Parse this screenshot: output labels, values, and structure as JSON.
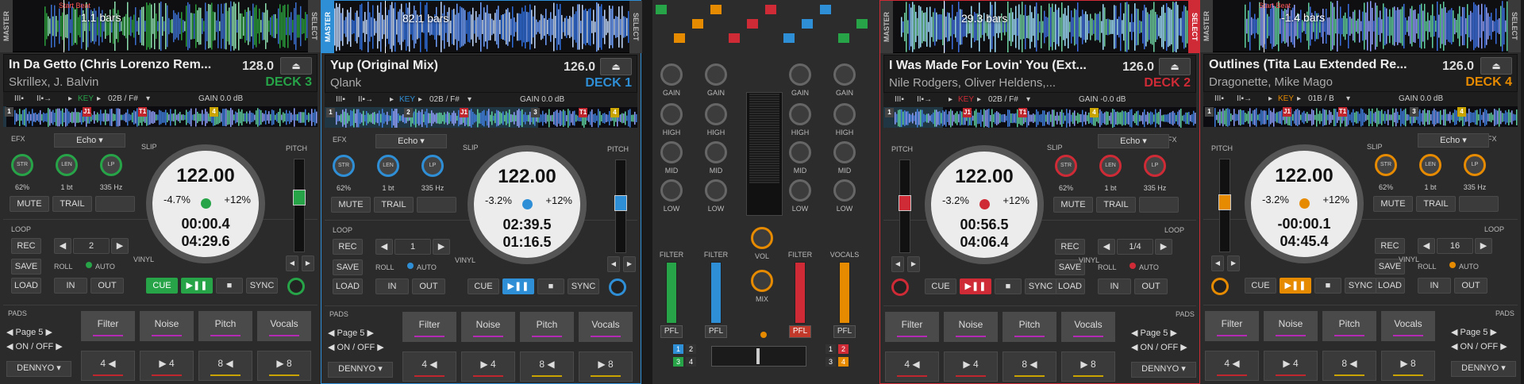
{
  "decks": [
    {
      "id": "deck3",
      "accent": "#27a348",
      "title": "In Da Getto (Chris Lorenzo Rem...",
      "artist": "Skrillex, J. Balvin",
      "bpm": "128.0",
      "deck_label": "DECK 3",
      "bars": "1.1 bars",
      "start_beat": "Start Beat",
      "key_label": "KEY",
      "key": "02B / F#",
      "gain": "GAIN 0.0 dB",
      "efx": "EFX",
      "effect": "Echo",
      "slip": "SLIP",
      "pitch": "PITCH",
      "str_label": "STR",
      "str": "62%",
      "len_label": "LEN",
      "len": "1 bt",
      "lp_label": "LP",
      "lp": "335 Hz",
      "mute": "MUTE",
      "trail": "TRAIL",
      "loop": "LOOP",
      "loop_size": "2",
      "rec": "REC",
      "save": "SAVE",
      "load": "LOAD",
      "roll": "ROLL",
      "auto": "AUTO",
      "in": "IN",
      "out": "OUT",
      "vinyl": "VINYL",
      "jog_bpm": "122.00",
      "pitch_minus": "-4.7%",
      "pitch_plus": "+12%",
      "time_elapsed": "00:00.4",
      "time_remain": "04:29.6",
      "cue": "CUE",
      "play": "▶❚❚",
      "stop": "■",
      "sync": "SYNC",
      "pads": "PADS",
      "page": "Page 5",
      "onoff": "ON / OFF",
      "user": "DENNYO",
      "pad_names": [
        "Filter",
        "Noise",
        "Pitch",
        "Vocals"
      ],
      "pad_bottom": [
        "4 ◀",
        "▶ 4",
        "8 ◀",
        "▶ 8"
      ],
      "cue_marks": [
        "1",
        "J1",
        "T1",
        "4"
      ],
      "master": "MASTER",
      "select": "SELECT",
      "progress": 0.01
    },
    {
      "id": "deck1",
      "accent": "#2f8fd6",
      "title": "Yup (Original Mix)",
      "artist": "Qlank",
      "bpm": "126.0",
      "deck_label": "DECK 1",
      "bars": "82.1 bars",
      "key_label": "KEY",
      "key": "02B / F#",
      "gain": "GAIN 0.0 dB",
      "efx": "EFX",
      "effect": "Echo",
      "slip": "SLIP",
      "pitch": "PITCH",
      "str_label": "STR",
      "str": "62%",
      "len_label": "LEN",
      "len": "1 bt",
      "lp_label": "LP",
      "lp": "335 Hz",
      "mute": "MUTE",
      "trail": "TRAIL",
      "loop": "LOOP",
      "loop_size": "1",
      "rec": "REC",
      "save": "SAVE",
      "load": "LOAD",
      "roll": "ROLL",
      "auto": "AUTO",
      "in": "IN",
      "out": "OUT",
      "vinyl": "VINYL",
      "jog_bpm": "122.00",
      "pitch_minus": "-3.2%",
      "pitch_plus": "+12%",
      "time_elapsed": "02:39.5",
      "time_remain": "01:16.5",
      "cue": "CUE",
      "play": "▶❚❚",
      "stop": "■",
      "sync": "SYNC",
      "pads": "PADS",
      "page": "Page 5",
      "onoff": "ON / OFF",
      "user": "DENNYO",
      "pad_names": [
        "Filter",
        "Noise",
        "Pitch",
        "Vocals"
      ],
      "pad_bottom": [
        "4 ◀",
        "▶ 4",
        "8 ◀",
        "▶ 8"
      ],
      "cue_marks": [
        "1",
        "2",
        "J1",
        "3",
        "T1",
        "4"
      ],
      "master": "MASTER",
      "select": "SELECT",
      "progress": 0.68
    },
    {
      "id": "deck2",
      "accent": "#cf2b36",
      "title": "I Was Made For Lovin' You (Ext...",
      "artist": "Nile Rodgers, Oliver Heldens,...",
      "bpm": "126.0",
      "deck_label": "DECK 2",
      "bars": "29.3 bars",
      "key_label": "KEY",
      "key": "02B / F#",
      "gain": "GAIN -0.0 dB",
      "efx": "EFX",
      "effect": "Echo",
      "slip": "SLIP",
      "pitch": "PITCH",
      "str_label": "STR",
      "str": "62%",
      "len_label": "LEN",
      "len": "1 bt",
      "lp_label": "LP",
      "lp": "335 Hz",
      "mute": "MUTE",
      "trail": "TRAIL",
      "loop": "LOOP",
      "loop_size": "1/4",
      "rec": "REC",
      "save": "SAVE",
      "load": "LOAD",
      "roll": "ROLL",
      "auto": "AUTO",
      "in": "IN",
      "out": "OUT",
      "vinyl": "VINYL",
      "jog_bpm": "122.00",
      "pitch_minus": "-3.2%",
      "pitch_plus": "+12%",
      "time_elapsed": "00:56.5",
      "time_remain": "04:06.4",
      "cue": "CUE",
      "play": "▶❚❚",
      "stop": "■",
      "sync": "SYNC",
      "pads": "PADS",
      "page": "Page 5",
      "onoff": "ON / OFF",
      "user": "DENNYO",
      "pad_names": [
        "Filter",
        "Noise",
        "Pitch",
        "Vocals"
      ],
      "pad_bottom": [
        "4 ◀",
        "▶ 4",
        "8 ◀",
        "▶ 8"
      ],
      "cue_marks": [
        "1",
        "J1",
        "T1",
        "4"
      ],
      "master": "MASTER",
      "select": "SELECT",
      "progress": 0.19
    },
    {
      "id": "deck4",
      "accent": "#e68a00",
      "title": "Outlines (Tita Lau Extended Re...",
      "artist": "Dragonette, Mike Mago",
      "bpm": "126.0",
      "deck_label": "DECK 4",
      "bars": "-1.4 bars",
      "start_beat": "Start Beat",
      "key_label": "KEY",
      "key": "01B / B",
      "gain": "GAIN 0.0 dB",
      "efx": "EFX",
      "effect": "Echo",
      "slip": "SLIP",
      "pitch": "PITCH",
      "str_label": "STR",
      "str": "62%",
      "len_label": "LEN",
      "len": "1 bt",
      "lp_label": "LP",
      "lp": "335 Hz",
      "mute": "MUTE",
      "trail": "TRAIL",
      "loop": "LOOP",
      "loop_size": "16",
      "rec": "REC",
      "save": "SAVE",
      "load": "LOAD",
      "roll": "ROLL",
      "auto": "AUTO",
      "in": "IN",
      "out": "OUT",
      "vinyl": "VINYL",
      "jog_bpm": "122.00",
      "pitch_minus": "-3.2%",
      "pitch_plus": "+12%",
      "time_elapsed": "-00:00.1",
      "time_remain": "04:45.4",
      "cue": "CUE",
      "play": "▶❚❚",
      "stop": "■",
      "sync": "SYNC",
      "pads": "PADS",
      "page": "Page 5",
      "onoff": "ON / OFF",
      "user": "DENNYO",
      "pad_names": [
        "Filter",
        "Noise",
        "Pitch",
        "Vocals"
      ],
      "pad_bottom": [
        "4 ◀",
        "▶ 4",
        "8 ◀",
        "▶ 8"
      ],
      "cue_marks": [
        "1",
        "J1",
        "T1",
        "3",
        "4"
      ],
      "master": "MASTER",
      "select": "SELECT",
      "progress": 0.0
    }
  ],
  "mixer": {
    "gain": "GAIN",
    "high": "HIGH",
    "mid": "MID",
    "low": "LOW",
    "filter": "FILTER",
    "vol": "VOL",
    "mix": "MIX",
    "vocals": "VOCALS",
    "pfl": "PFL",
    "nums": [
      "1",
      "2",
      "3",
      "4"
    ]
  }
}
